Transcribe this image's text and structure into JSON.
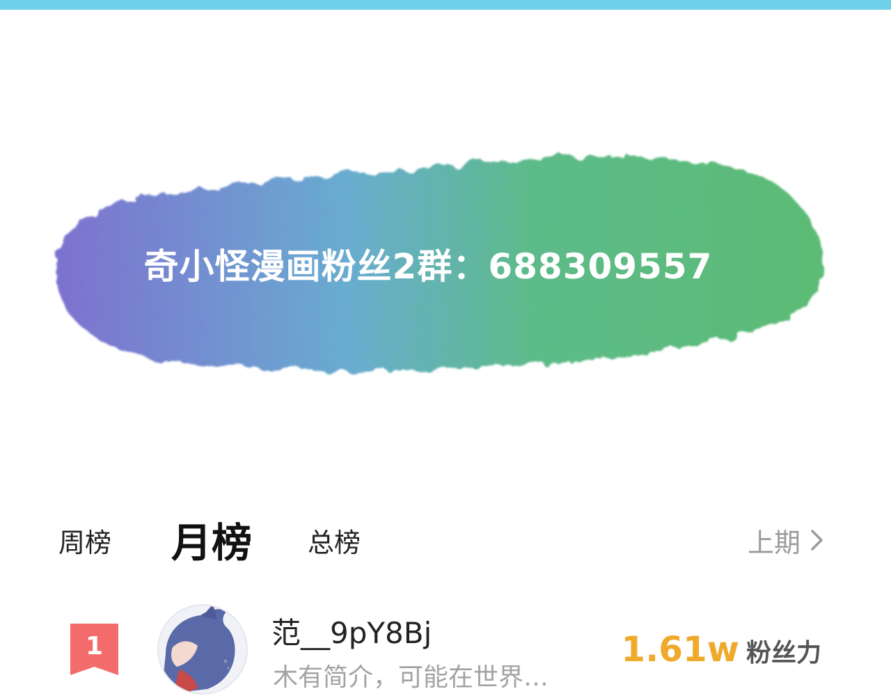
{
  "colors": {
    "top_border": "#6fd0ea",
    "banner_gradient": [
      "#7d71cf",
      "#69acd0",
      "#5dbb8a",
      "#5cbb74"
    ],
    "rank_badge": "#f36b6b",
    "fans_value": "#efaa2c"
  },
  "banner": {
    "text": "奇小怪漫画粉丝2群：688309557"
  },
  "tabs": {
    "week": "周榜",
    "month": "月榜",
    "total": "总榜",
    "active": "month"
  },
  "prev_link": {
    "label": "上期",
    "icon": "chevron-right-icon"
  },
  "ranking": [
    {
      "rank": "1",
      "name": "范__9pY8Bj",
      "bio": "木有简介，可能在世界…",
      "fans_value": "1.61w",
      "fans_label": "粉丝力",
      "avatar_icon": "anime-avatar"
    }
  ]
}
